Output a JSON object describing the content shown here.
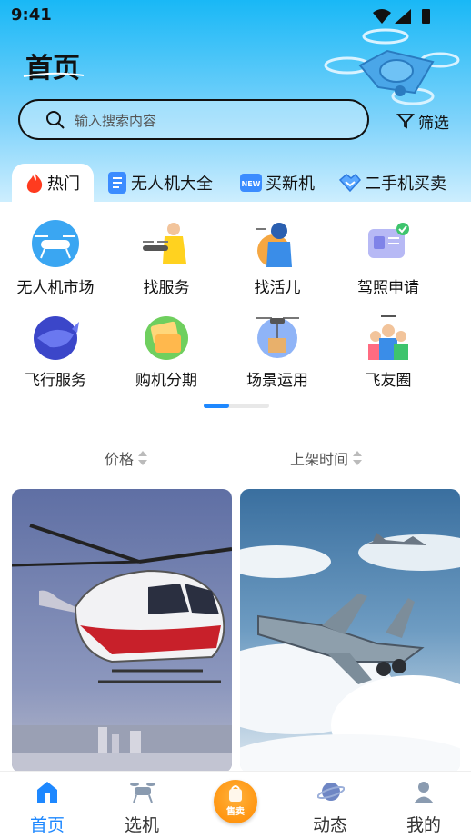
{
  "status_bar": {
    "time": "9:41"
  },
  "header": {
    "title": "首页",
    "search_placeholder": "输入搜索内容",
    "filter_label": "筛选"
  },
  "tabs": [
    {
      "label": "热门",
      "icon": "flame-icon",
      "active": true
    },
    {
      "label": "无人机大全",
      "icon": "document-icon",
      "active": false
    },
    {
      "label": "买新机",
      "icon": "new-badge-icon",
      "active": false
    },
    {
      "label": "二手机买卖",
      "icon": "handshake-icon",
      "active": false
    }
  ],
  "grid": {
    "row1": [
      {
        "label": "无人机市场",
        "icon": "drone-icon"
      },
      {
        "label": "找服务",
        "icon": "service-worker-icon"
      },
      {
        "label": "找活儿",
        "icon": "pilot-icon"
      },
      {
        "label": "驾照申请",
        "icon": "license-icon"
      }
    ],
    "row2": [
      {
        "label": "飞行服务",
        "icon": "whale-icon"
      },
      {
        "label": "购机分期",
        "icon": "installment-icon"
      },
      {
        "label": "场景运用",
        "icon": "delivery-drone-icon"
      },
      {
        "label": "飞友圈",
        "icon": "group-icon"
      }
    ]
  },
  "sort": {
    "price": "价格",
    "listing_time": "上架时间"
  },
  "listings": [
    {
      "image": "helicopter-photo"
    },
    {
      "image": "fighter-jets-photo"
    }
  ],
  "bottom_nav": [
    {
      "label": "首页",
      "icon": "home-icon",
      "active": true
    },
    {
      "label": "选机",
      "icon": "drone-select-icon",
      "active": false
    },
    {
      "label": "",
      "icon": "sell-bag-icon",
      "active": false
    },
    {
      "label": "动态",
      "icon": "planet-icon",
      "active": false
    },
    {
      "label": "我的",
      "icon": "profile-icon",
      "active": false
    }
  ],
  "sell_button": {
    "label": "售卖"
  },
  "colors": {
    "accent": "#1e88ff",
    "header_top": "#19b8f6",
    "sell": "#ff8a00"
  }
}
